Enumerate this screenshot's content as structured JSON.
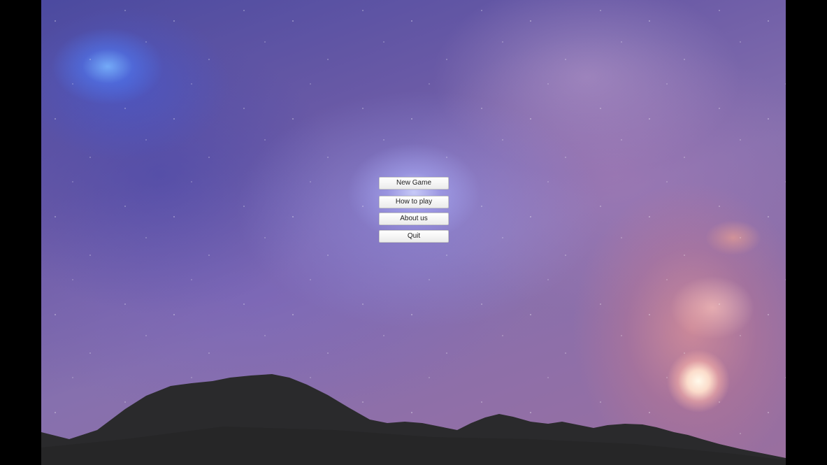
{
  "main_menu": {
    "buttons": [
      {
        "label": "New Game"
      },
      {
        "label": "How to play"
      },
      {
        "label": "About us"
      },
      {
        "label": "Quit"
      }
    ]
  }
}
